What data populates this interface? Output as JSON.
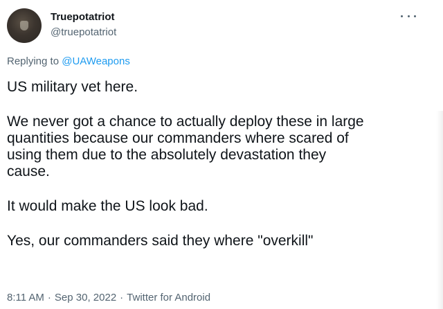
{
  "author": {
    "display_name": "Truepotatriot",
    "handle": "@truepotatriot",
    "avatar_icon": "profile-picture-dark"
  },
  "more_icon": "more-horizontal-icon",
  "reply": {
    "prefix": "Replying to",
    "mention": "@UAWeapons"
  },
  "tweet": {
    "paragraphs": [
      [
        "US military vet here."
      ],
      [
        "We never got a chance to actually deploy these in large",
        "quantities because our commanders where scared of",
        "using them due to the absolutely devastation they",
        "cause."
      ],
      [
        "It would make the US look bad."
      ],
      [
        "Yes, our commanders said they where \"overkill\""
      ]
    ]
  },
  "meta": {
    "time": "8:11 AM",
    "date": "Sep 30, 2022",
    "source": "Twitter for Android",
    "separator": "·"
  },
  "colors": {
    "text_primary": "#0f1419",
    "text_secondary": "#536471",
    "link": "#1d9bf0",
    "background": "#ffffff"
  }
}
